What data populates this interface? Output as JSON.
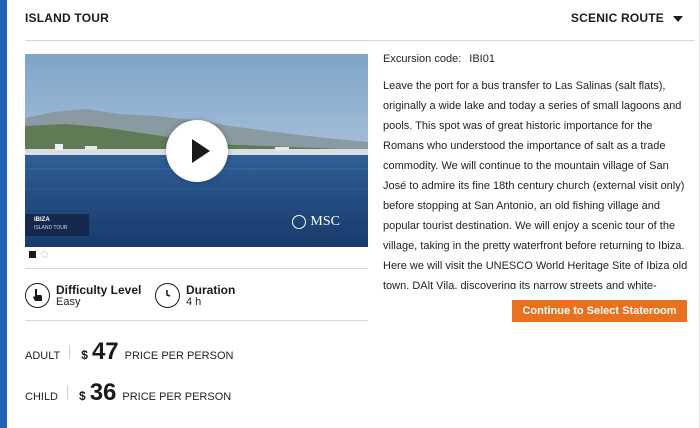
{
  "header": {
    "title": "ISLAND TOUR",
    "route_label": "SCENIC ROUTE"
  },
  "video": {
    "caption_title": "IBIZA",
    "caption_subtitle": "ISLAND TOUR",
    "brand": "MSC",
    "play_icon": "play-icon",
    "carousel_active_index": 0,
    "carousel_count": 2
  },
  "details": {
    "difficulty_label": "Difficulty Level",
    "difficulty_value": "Easy",
    "difficulty_icon": "hand-pointer-icon",
    "duration_label": "Duration",
    "duration_value": "4 h",
    "duration_icon": "clock-icon"
  },
  "pricing": {
    "adult_label": "ADULT",
    "adult_currency": "$",
    "adult_price": "47",
    "child_label": "CHILD",
    "child_currency": "$",
    "child_price": "36",
    "per_person": "PRICE PER PERSON"
  },
  "excursion": {
    "code_label": "Excursion code:",
    "code_value": "IBI01",
    "description": "Leave the port for a bus transfer to Las Salinas (salt flats), originally a wide lake and today a series of small lagoons and pools. This spot was of great historic importance for the Romans who understood the importance of salt as a trade commodity. We will continue to the mountain village of San José to admire its fine 18th century church (external visit only) before stopping at San Antonio, an old fishing village and popular tourist destination. We will enjoy a scenic tour of the village, taking in the pretty waterfront before returning to Ibiza. Here we will visit the UNESCO World Heritage Site of Ibiza old town, DAlt Vila, discovering its narrow streets and white-washed houses. Return to the",
    "cta_label": "Continue to Select Stateroom"
  },
  "colors": {
    "accent": "#1f5fb8",
    "cta": "#e9701c"
  }
}
